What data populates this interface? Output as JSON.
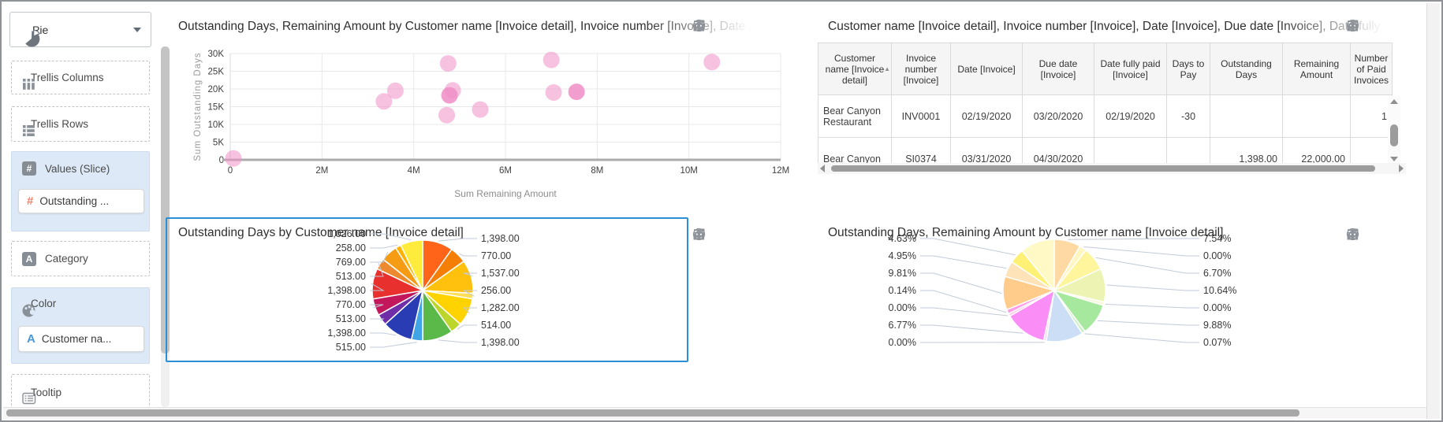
{
  "app": {
    "accent_color": "#2B8FD6",
    "selected_panel": "pie_values"
  },
  "sidebar": {
    "chart_type": {
      "label": "Pie",
      "icon": "pie-chart-icon"
    },
    "sections": [
      {
        "label": "Trellis Columns",
        "icon": "columns-icon",
        "style": "dashed"
      },
      {
        "label": "Trellis Rows",
        "icon": "rows-icon",
        "style": "dashed"
      },
      {
        "label": "Values (Slice)",
        "icon": "hash-icon",
        "style": "filled",
        "chip": {
          "label": "Outstanding ...",
          "icon": "hash-icon",
          "icon_color": "#F2836F"
        }
      },
      {
        "label": "Category",
        "icon": "letter-a-icon",
        "style": "dashed"
      },
      {
        "label": "Color",
        "icon": "palette-icon",
        "style": "filled",
        "chip": {
          "label": "Customer na...",
          "icon": "letter-a-icon",
          "icon_color": "#4D96D9"
        }
      },
      {
        "label": "Tooltip",
        "icon": "tooltip-icon",
        "style": "dashed"
      }
    ]
  },
  "panels": {
    "scatter": {
      "title": "Outstanding Days, Remaining Amount by Customer name [Invoice detail], Invoice number [Invoice], Date [Invoice]",
      "chart_data": {
        "type": "scatter",
        "xlabel": "Sum Remaining Amount",
        "ylabel": "Sum Outstanding Days",
        "x_ticks": [
          "0",
          "2M",
          "4M",
          "6M",
          "8M",
          "10M",
          "12M"
        ],
        "y_ticks": [
          "0",
          "5K",
          "10K",
          "15K",
          "20K",
          "25K",
          "30K"
        ],
        "xlim": [
          0,
          12000000
        ],
        "ylim": [
          0,
          30000
        ],
        "point_color": "#F08EC7",
        "points": [
          {
            "x": 70000,
            "y": 400
          },
          {
            "x": 3350000,
            "y": 16500
          },
          {
            "x": 3600000,
            "y": 19500
          },
          {
            "x": 4750000,
            "y": 27200
          },
          {
            "x": 4850000,
            "y": 19600
          },
          {
            "x": 4780000,
            "y": 18200,
            "dark": true
          },
          {
            "x": 4720000,
            "y": 12600
          },
          {
            "x": 5450000,
            "y": 14200
          },
          {
            "x": 7000000,
            "y": 28200
          },
          {
            "x": 7050000,
            "y": 19000
          },
          {
            "x": 7550000,
            "y": 19200,
            "dark": true
          },
          {
            "x": 10500000,
            "y": 27600
          }
        ]
      }
    },
    "table": {
      "title": "Customer name [Invoice detail], Invoice number [Invoice], Date [Invoice], Due date [Invoice], Date fully paid [Invoice]",
      "columns": [
        {
          "label": "Customer name [Invoice detail]",
          "sort": "asc"
        },
        {
          "label": "Invoice number [Invoice]"
        },
        {
          "label": "Date [Invoice]"
        },
        {
          "label": "Due date [Invoice]"
        },
        {
          "label": "Date fully paid [Invoice]"
        },
        {
          "label": "Days to Pay"
        },
        {
          "label": "Outstanding Days"
        },
        {
          "label": "Remaining Amount"
        },
        {
          "label": "Number of Paid Invoices"
        }
      ],
      "rows": [
        [
          "Bear Canyon Restaurant",
          "INV0001",
          "02/19/2020",
          "03/20/2020",
          "02/19/2020",
          "-30",
          "",
          "",
          "1"
        ],
        [
          "Bear Canyon",
          "SI0374",
          "03/31/2020",
          "04/30/2020",
          "",
          "",
          "1,398.00",
          "22,000.00",
          ""
        ]
      ]
    },
    "pie_values": {
      "title": "Outstanding Days by Customer name [Invoice detail]",
      "chart_data": {
        "type": "pie",
        "value_format": "absolute",
        "slices": [
          {
            "value": 1398,
            "label": "1,398.00",
            "color": "#FF6418"
          },
          {
            "value": 770,
            "label": "770.00",
            "color": "#F57F06"
          },
          {
            "value": 1537,
            "label": "1,537.00",
            "color": "#FFC10D"
          },
          {
            "value": 256,
            "label": "256.00",
            "color": "#FFDE59"
          },
          {
            "value": 1282,
            "label": "1,282.00",
            "color": "#FFD300"
          },
          {
            "value": 514,
            "label": "514.00",
            "color": "#BCD62C"
          },
          {
            "value": 1398,
            "label": "1,398.00",
            "color": "#5BB949"
          },
          {
            "value": 515,
            "label": "515.00",
            "color": "#41A4E6"
          },
          {
            "value": 1398,
            "label": "1,398.00",
            "color": "#2A3CB4"
          },
          {
            "value": 513,
            "label": "513.00",
            "color": "#6F2DA8"
          },
          {
            "value": 770,
            "label": "770.00",
            "color": "#C2185B"
          },
          {
            "value": 1398,
            "label": "1,398.00",
            "color": "#E8302E"
          },
          {
            "value": 513,
            "label": "513.00",
            "color": "#ED8A2F"
          },
          {
            "value": 769,
            "label": "769.00",
            "color": "#F59B14"
          },
          {
            "value": 258,
            "label": "258.00",
            "color": "#FFB300"
          },
          {
            "value": 1026,
            "label": "1,026.00",
            "color": "#FFEB3B"
          }
        ]
      }
    },
    "pie_percent": {
      "title": "Outstanding Days, Remaining Amount by Customer name [Invoice detail]",
      "chart_data": {
        "type": "pie",
        "value_format": "percent",
        "slices": [
          {
            "value": 30,
            "label": "7.54%",
            "color": "#FFD9A3"
          },
          {
            "value": 8,
            "label": "0.00%",
            "color": "#FFF6C0"
          },
          {
            "value": 27,
            "label": "6.70%",
            "color": "#FFF59D"
          },
          {
            "value": 38,
            "label": "10.64%",
            "color": "#EDF3B2"
          },
          {
            "value": 4,
            "label": "0.00%",
            "color": "#F7F9D8"
          },
          {
            "value": 36,
            "label": "9.88%",
            "color": "#A6E89E"
          },
          {
            "value": 4,
            "label": "0.07%",
            "color": "#CDEFC5"
          },
          {
            "value": 42,
            "label": "",
            "color": "#CBDEF6"
          },
          {
            "value": 3,
            "label": "0.00%",
            "color": "#FFD7F2"
          },
          {
            "value": 48,
            "label": "6.77%",
            "color": "#FB8DF6"
          },
          {
            "value": 3,
            "label": "0.00%",
            "color": "#FFC3EE"
          },
          {
            "value": 5,
            "label": "0.14%",
            "color": "#FF9DE8"
          },
          {
            "value": 38,
            "label": "9.81%",
            "color": "#FFCC8C"
          },
          {
            "value": 18,
            "label": "4.95%",
            "color": "#FFE3B8"
          },
          {
            "value": 17,
            "label": "4.63%",
            "color": "#FFF176"
          },
          {
            "value": 39,
            "label": "",
            "color": "#FFF9C6"
          }
        ]
      }
    }
  }
}
